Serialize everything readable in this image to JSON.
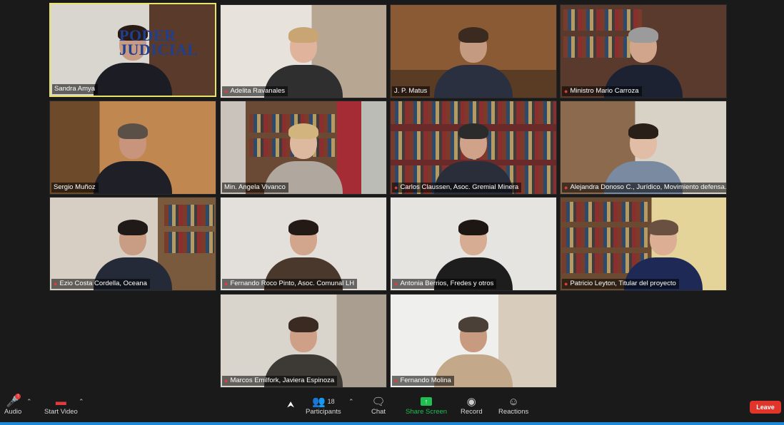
{
  "participants": [
    {
      "name": "Sandra Amya"
    },
    {
      "name": "Adelita Ravanales"
    },
    {
      "name": "J. P. Matus"
    },
    {
      "name": "Ministro Mario Carroza"
    },
    {
      "name": "Sergio Muñoz"
    },
    {
      "name": "Min. Angela Vivanco"
    },
    {
      "name": "Carlos Claussen, Asoc. Gremial Minera"
    },
    {
      "name": "Alejandra Donoso C., Jurídico, Movimiento defensa..."
    },
    {
      "name": "Ezio Costa Cordella, Oceana"
    },
    {
      "name": "Fernando Roco Pinto, Asoc. Comunal LH"
    },
    {
      "name": "Antonia Berrios, Fredes y otros"
    },
    {
      "name": "Patricio Leyton, Titular del proyecto"
    },
    {
      "name": "Marcos Emilfork, Javiera Espinoza"
    },
    {
      "name": "Fernando Molina"
    }
  ],
  "logo": {
    "line1": "PODER",
    "line2": "JUDICIAL"
  },
  "toolbar": {
    "audio": "Audio",
    "start_video": "Start Video",
    "participants": "Participants",
    "participants_count": "18",
    "chat": "Chat",
    "share_screen": "Share Screen",
    "record": "Record",
    "reactions": "Reactions",
    "leave": "Leave"
  },
  "colors": {
    "accent_share": "#1fbf52",
    "leave": "#e0352b",
    "active_speaker": "#e8e46a",
    "mic_off": "#e23b3b"
  }
}
